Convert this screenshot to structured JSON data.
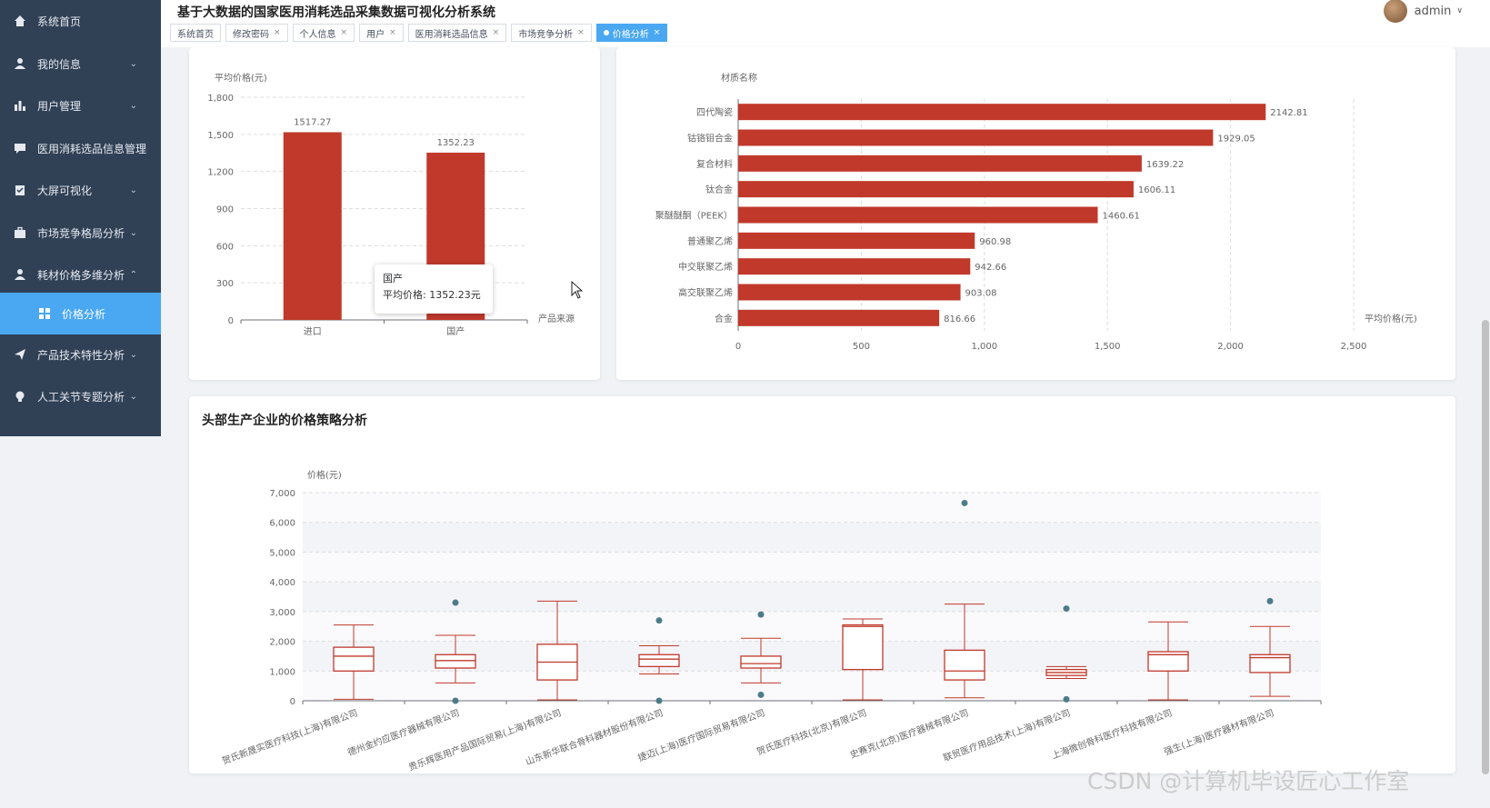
{
  "app": {
    "title": "基于大数据的国家医用消耗选品采集数据可视化分析系统",
    "user": "admin"
  },
  "sidebar": {
    "items": [
      {
        "label": "系统首页",
        "icon": "home-icon"
      },
      {
        "label": "我的信息",
        "icon": "user-icon",
        "expandable": true
      },
      {
        "label": "用户管理",
        "icon": "bar-chart-icon",
        "expandable": true
      },
      {
        "label": "医用消耗选品信息管理",
        "icon": "comment-icon"
      },
      {
        "label": "大屏可视化",
        "icon": "clipboard-icon",
        "expandable": true
      },
      {
        "label": "市场竞争格局分析",
        "icon": "briefcase-icon",
        "expandable": true
      },
      {
        "label": "耗材价格多维分析",
        "icon": "user-icon",
        "expanded": true
      },
      {
        "label": "价格分析",
        "icon": "grid-icon",
        "active": true,
        "sub": true
      },
      {
        "label": "产品技术特性分析",
        "icon": "send-icon",
        "expandable": true
      },
      {
        "label": "人工关节专题分析",
        "icon": "bulb-icon",
        "expandable": true
      }
    ]
  },
  "tabs": [
    {
      "label": "系统首页"
    },
    {
      "label": "修改密码",
      "closable": true
    },
    {
      "label": "个人信息",
      "closable": true
    },
    {
      "label": "用户",
      "closable": true
    },
    {
      "label": "医用消耗选品信息",
      "closable": true
    },
    {
      "label": "市场竞争分析",
      "closable": true
    },
    {
      "label": "价格分析",
      "closable": true,
      "active": true
    }
  ],
  "tooltip": {
    "title": "国产",
    "body": "平均价格: 1352.23元"
  },
  "card3": {
    "title": "头部生产企业的价格策略分析"
  },
  "watermark": "CSDN @计算机毕设匠心工作室",
  "colors": {
    "bar": "#c0392b",
    "sidebar": "#304156",
    "accent": "#4aa8f2",
    "outlier": "#4d7b8a"
  },
  "chart_data": [
    {
      "type": "bar",
      "ylabel": "平均价格(元)",
      "xlabel": "产品来源",
      "categories": [
        "进口",
        "国产"
      ],
      "values": [
        1517.27,
        1352.23
      ],
      "ylim": [
        0,
        1800
      ],
      "yticks": [
        0,
        300,
        600,
        900,
        1200,
        1500,
        1800
      ],
      "ytick_labels": [
        "0",
        "300",
        "600",
        "900",
        "1,200",
        "1,500",
        "1,800"
      ],
      "grid": true
    },
    {
      "type": "bar",
      "orientation": "horizontal",
      "ylabel": "材质名称",
      "xlabel": "平均价格(元)",
      "categories": [
        "四代陶瓷",
        "钴铬钼合金",
        "复合材料",
        "钛合金",
        "聚醚醚酮（PEEK）",
        "普通聚乙烯",
        "中交联聚乙烯",
        "高交联聚乙烯",
        "合金"
      ],
      "values": [
        2142.81,
        1929.05,
        1639.22,
        1606.11,
        1460.61,
        960.98,
        942.66,
        903.08,
        816.66
      ],
      "xlim": [
        0,
        2500
      ],
      "xticks": [
        0,
        500,
        1000,
        1500,
        2000,
        2500
      ],
      "xtick_labels": [
        "0",
        "500",
        "1,000",
        "1,500",
        "2,000",
        "2,500"
      ],
      "grid": true
    },
    {
      "type": "boxplot",
      "ylabel": "价格(元)",
      "ylim": [
        0,
        7000
      ],
      "yticks": [
        0,
        1000,
        2000,
        3000,
        4000,
        5000,
        6000,
        7000
      ],
      "ytick_labels": [
        "0",
        "1,000",
        "2,000",
        "3,000",
        "4,000",
        "5,000",
        "6,000",
        "7,000"
      ],
      "categories": [
        "贺氏新晟实医疗科技(上海)有限公司",
        "德州金约应医疗器械有限公司",
        "贵乐辉医用产品国际贸易(上海)有限公司",
        "山东新华联合骨科器材股份有限公司",
        "捷迈(上海)医疗国际贸易有限公司",
        "贺氏医疗科技(北京)有限公司",
        "史赛克(北京)医疗器械有限公司",
        "联贸医疗用品技术(上海)有限公司",
        "上海微创骨科医疗科技有限公司",
        "强生(上海)医疗器材有限公司"
      ],
      "boxes": [
        {
          "min": 50,
          "q1": 1000,
          "median": 1500,
          "q3": 1800,
          "max": 2550
        },
        {
          "min": 600,
          "q1": 1100,
          "median": 1350,
          "q3": 1550,
          "max": 2200
        },
        {
          "min": 30,
          "q1": 700,
          "median": 1300,
          "q3": 1900,
          "max": 3350
        },
        {
          "min": 900,
          "q1": 1150,
          "median": 1400,
          "q3": 1550,
          "max": 1850
        },
        {
          "min": 600,
          "q1": 1100,
          "median": 1250,
          "q3": 1500,
          "max": 2100
        },
        {
          "min": 30,
          "q1": 1050,
          "median": 2500,
          "q3": 2550,
          "max": 2750
        },
        {
          "min": 100,
          "q1": 700,
          "median": 1000,
          "q3": 1700,
          "max": 3250
        },
        {
          "min": 750,
          "q1": 850,
          "median": 950,
          "q3": 1050,
          "max": 1150
        },
        {
          "min": 30,
          "q1": 1000,
          "median": 1550,
          "q3": 1650,
          "max": 2650
        },
        {
          "min": 150,
          "q1": 950,
          "median": 1450,
          "q3": 1550,
          "max": 2500
        }
      ],
      "outliers": [
        [
          1,
          3300
        ],
        [
          1,
          0
        ],
        [
          3,
          2700
        ],
        [
          3,
          0
        ],
        [
          4,
          2900
        ],
        [
          4,
          200
        ],
        [
          6,
          6650
        ],
        [
          7,
          3100
        ],
        [
          7,
          50
        ],
        [
          9,
          3350
        ]
      ],
      "grid": true
    }
  ]
}
